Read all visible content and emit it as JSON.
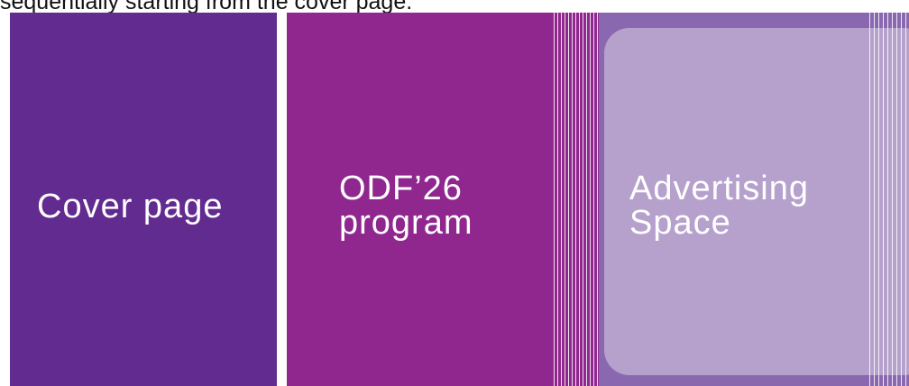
{
  "caption": "sequentially starting from the cover page.",
  "colors": {
    "cover": "#622b8f",
    "program": "#8f278f",
    "advertising": "#8a68af"
  },
  "panels": {
    "cover": {
      "label": "Cover page"
    },
    "program": {
      "label_line1": "ODF’26",
      "label_line2": "program"
    },
    "advertising": {
      "label_line1": "Advertising",
      "label_line2": "Space"
    }
  }
}
